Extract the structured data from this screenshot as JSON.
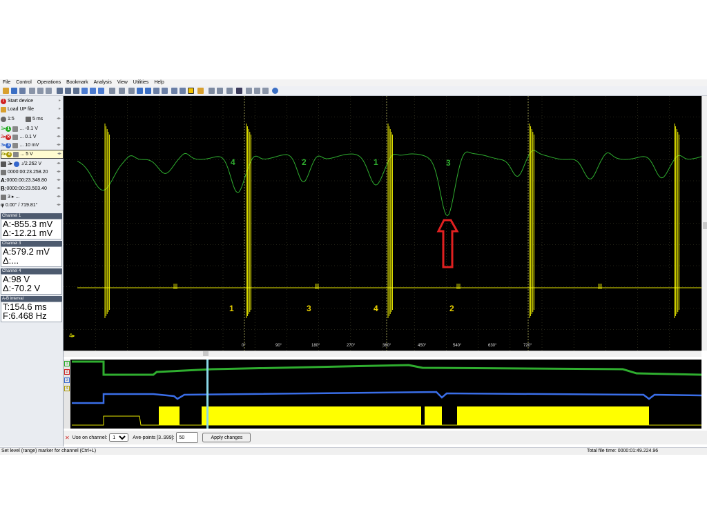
{
  "menu": [
    "File",
    "Control",
    "Operations",
    "Bookmark",
    "Analysis",
    "View",
    "Utilities",
    "Help"
  ],
  "panel": {
    "start_device": "Start device",
    "load_file": "Load UP file",
    "zoom": "1:5",
    "timebase": "5 ms",
    "ch1_scale": "... -0.1 V",
    "ch2_scale": "... 0.1 V",
    "ch3_scale": "... 10 mV",
    "ch4_scale": "... 5 V",
    "trigger_level": "↓/2.262 V",
    "trigger_time": "0000:00:23.258.20",
    "marker_a_label": "A:",
    "marker_a_time": "0000:00:23.348.80",
    "marker_b_label": "B:",
    "marker_b_time": "0000:00:23.503.40",
    "channel_sel": "3",
    "phase": "0.00° / 719.81°",
    "ch1_header": "Channel 1",
    "ch1_a": "A:-855.3 mV",
    "ch1_delta": "Δ:-12.21 mV",
    "ch3_header": "Channel 3",
    "ch3_a": "A:579.2 mV",
    "ch3_delta": "Δ:...",
    "ch4_header": "Channel 4",
    "ch4_a": "A:98 V",
    "ch4_delta": "Δ:-70.2 V",
    "ab_header": "A-B interval",
    "ab_t": "T:154.6 ms",
    "ab_f": "F:6.468 Hz"
  },
  "scope": {
    "channel_marker": "4▸",
    "degree_ticks": [
      "0°",
      "90°",
      "180°",
      "270°",
      "360°",
      "450°",
      "540°",
      "630°",
      "720°"
    ],
    "green_labels": [
      "4",
      "2",
      "1",
      "3"
    ],
    "yellow_labels": [
      "1",
      "3",
      "4",
      "2"
    ],
    "colors": {
      "green": "#2fae2f",
      "yellow": "#ffff00",
      "blue": "#3a6ee8",
      "arrow": "#e02020"
    }
  },
  "overview": {
    "channels": [
      "1",
      "2",
      "3",
      "4"
    ]
  },
  "averaging": {
    "use_on_channel_label": "Use on channel:",
    "channel_value": "1",
    "avepoints_label": "Ave-points [3..999]:",
    "avepoints_value": "50",
    "apply_label": "Apply changes"
  },
  "status": {
    "hint": "Set level (range) marker for channel (Ctrl+L)",
    "total_time": "Total file time: 0000:01:49.224.96"
  }
}
